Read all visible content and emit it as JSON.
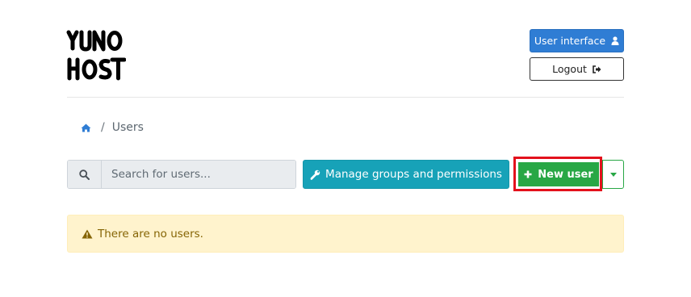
{
  "brand": {
    "logo_text": "YUNO HOST"
  },
  "header": {
    "user_interface_label": "User interface",
    "logout_label": "Logout"
  },
  "breadcrumb": {
    "current": "Users"
  },
  "toolbar": {
    "search_placeholder": "Search for users...",
    "manage_label": "Manage groups and permissions",
    "new_user_label": "New user"
  },
  "alert": {
    "message": "There are no users."
  },
  "colors": {
    "primary": "#2f7dd4",
    "info": "#17a2b8",
    "success": "#28a745",
    "warning_bg": "#fff3cd",
    "warning_text": "#856404",
    "highlight": "#e3111c"
  },
  "icons": [
    "user-icon",
    "sign-out-icon",
    "home-icon",
    "search-icon",
    "wrench-icon",
    "plus-icon",
    "caret-down-icon",
    "warning-icon"
  ]
}
